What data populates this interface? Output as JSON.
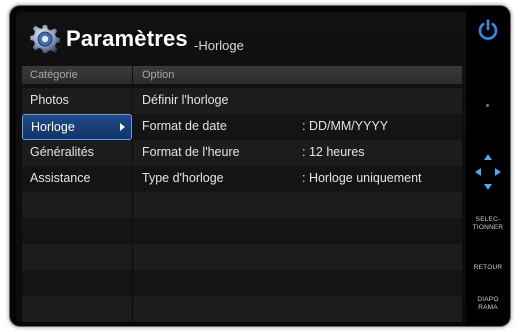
{
  "header": {
    "title": "Paramètres",
    "subtitle": "-Horloge"
  },
  "columns": {
    "category": "Catégorie",
    "option": "Option"
  },
  "categories": [
    {
      "label": "Photos"
    },
    {
      "label": "Horloge",
      "selected": true
    },
    {
      "label": "Généralités"
    },
    {
      "label": "Assistance"
    }
  ],
  "options": [
    {
      "label": "Définir l'horloge",
      "value": ""
    },
    {
      "label": "Format de date",
      "value": ": DD/MM/YYYY"
    },
    {
      "label": "Format de l'heure",
      "value": ": 12 heures"
    },
    {
      "label": "Type d'horloge",
      "value": ": Horloge uniquement"
    }
  ],
  "side_buttons": {
    "select": "SELEC-\nTIONNER",
    "back": "RETOUR",
    "slideshow": "DIAPO\nRAMA"
  },
  "colors": {
    "selection": "#1d4a8a",
    "selection_border": "#6d9ee0",
    "accent_icon": "#2f8fe8"
  }
}
